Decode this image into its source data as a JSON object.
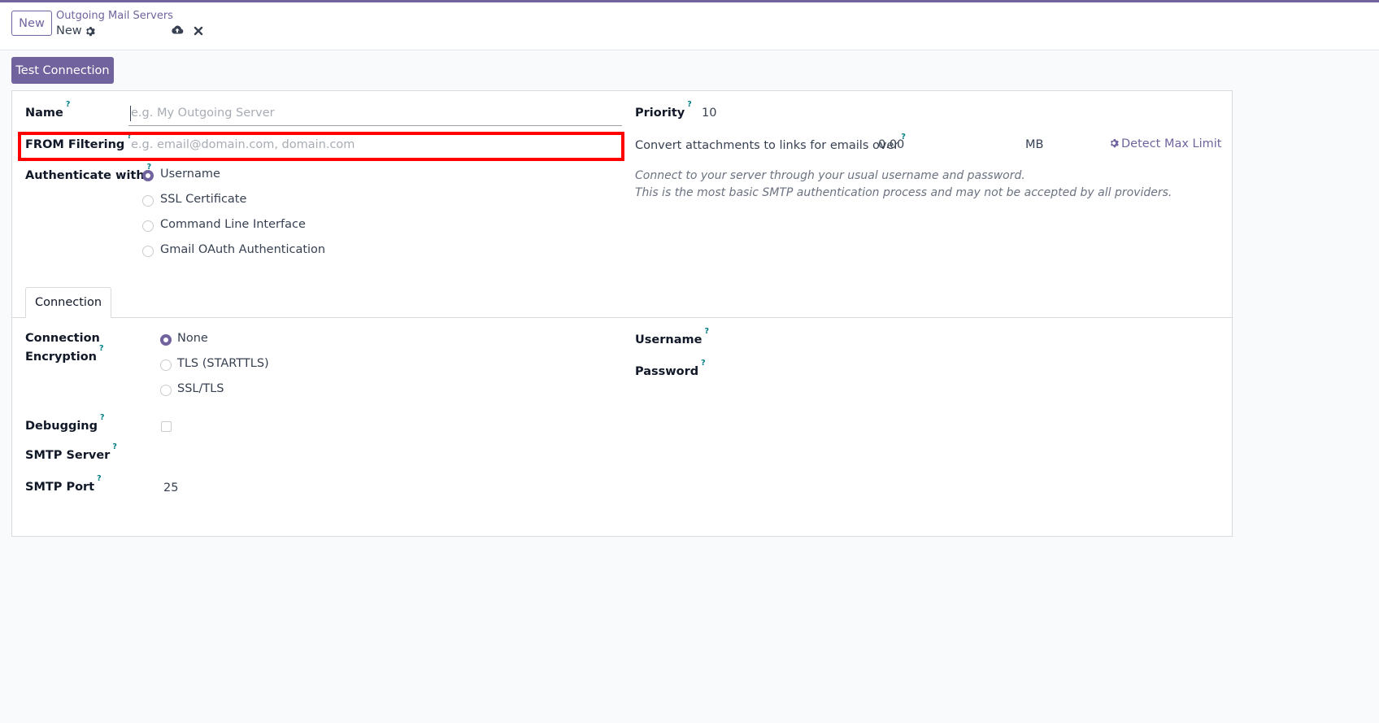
{
  "control_panel": {
    "new_button": "New",
    "breadcrumb_parent": "Outgoing Mail Servers",
    "breadcrumb_current": "New"
  },
  "actions": {
    "test_connection": "Test Connection"
  },
  "form": {
    "name": {
      "label": "Name",
      "help": "?",
      "placeholder": "e.g. My Outgoing Server",
      "value": ""
    },
    "from_filter": {
      "label": "FROM Filtering",
      "help": "?",
      "placeholder": "e.g. email@domain.com, domain.com",
      "value": ""
    },
    "authenticate": {
      "label": "Authenticate with",
      "help": "?",
      "options": [
        "Username",
        "SSL Certificate",
        "Command Line Interface",
        "Gmail OAuth Authentication"
      ],
      "selected": "Username"
    },
    "priority": {
      "label": "Priority",
      "help": "?",
      "value": "10"
    },
    "attachments": {
      "label": "Convert attachments to links for emails over",
      "help": "?",
      "value": "0.00",
      "unit": "MB"
    },
    "detect_limit": "Detect Max Limit",
    "auth_description": [
      "Connect to your server through your usual username and password.",
      "This is the most basic SMTP authentication process and may not be accepted by all providers."
    ]
  },
  "tabs": [
    {
      "label": "Connection",
      "active": true
    }
  ],
  "connection": {
    "encryption": {
      "label_line1": "Connection",
      "label_line2": "Encryption",
      "help": "?",
      "options": [
        "None",
        "TLS (STARTTLS)",
        "SSL/TLS"
      ],
      "selected": "None"
    },
    "debugging": {
      "label": "Debugging",
      "help": "?",
      "checked": false
    },
    "smtp_server": {
      "label": "SMTP Server",
      "help": "?",
      "value": ""
    },
    "smtp_port": {
      "label": "SMTP Port",
      "help": "?",
      "value": "25"
    },
    "username": {
      "label": "Username",
      "help": "?",
      "value": ""
    },
    "password": {
      "label": "Password",
      "help": "?",
      "value": ""
    }
  },
  "colors": {
    "brand": "#71639e",
    "help": "#017e84",
    "highlight": "#ff0000"
  },
  "icons": [
    "gear-icon",
    "cloud-upload-icon",
    "close-icon"
  ]
}
